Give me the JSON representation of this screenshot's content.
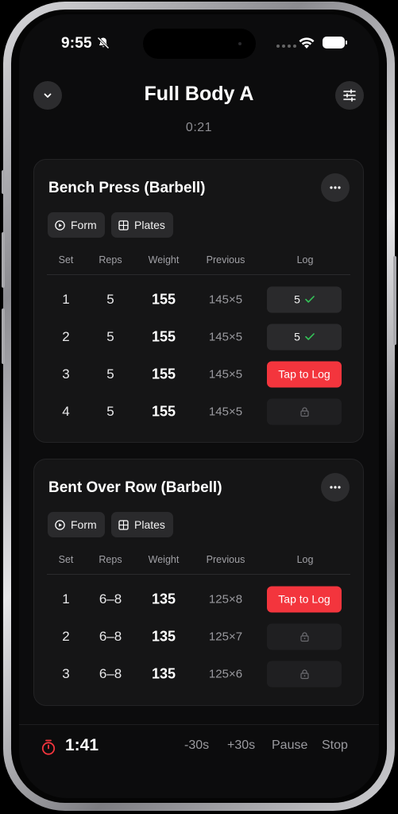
{
  "status_bar": {
    "time": "9:55"
  },
  "header": {
    "title": "Full Body A",
    "elapsed": "0:21",
    "collapse_icon": "chevron-down-icon",
    "settings_icon": "sliders-icon"
  },
  "table_headers": {
    "set": "Set",
    "reps": "Reps",
    "weight": "Weight",
    "previous": "Previous",
    "log": "Log"
  },
  "exercises": [
    {
      "name": "Bench Press (Barbell)",
      "chips": {
        "form": "Form",
        "plates": "Plates"
      },
      "sets": [
        {
          "set": "1",
          "reps": "5",
          "weight": "155",
          "previous": "145×5",
          "log": {
            "state": "done",
            "value": "5"
          }
        },
        {
          "set": "2",
          "reps": "5",
          "weight": "155",
          "previous": "145×5",
          "log": {
            "state": "done",
            "value": "5"
          }
        },
        {
          "set": "3",
          "reps": "5",
          "weight": "155",
          "previous": "145×5",
          "log": {
            "state": "active",
            "value": "Tap to Log"
          }
        },
        {
          "set": "4",
          "reps": "5",
          "weight": "155",
          "previous": "145×5",
          "log": {
            "state": "locked",
            "value": ""
          }
        }
      ]
    },
    {
      "name": "Bent Over Row (Barbell)",
      "chips": {
        "form": "Form",
        "plates": "Plates"
      },
      "sets": [
        {
          "set": "1",
          "reps": "6–8",
          "weight": "135",
          "previous": "125×8",
          "log": {
            "state": "active",
            "value": "Tap to Log"
          }
        },
        {
          "set": "2",
          "reps": "6–8",
          "weight": "135",
          "previous": "125×7",
          "log": {
            "state": "locked",
            "value": ""
          }
        },
        {
          "set": "3",
          "reps": "6–8",
          "weight": "135",
          "previous": "125×6",
          "log": {
            "state": "locked",
            "value": ""
          }
        }
      ]
    }
  ],
  "rest_timer": {
    "time": "1:41",
    "actions": {
      "minus": "-30s",
      "plus": "+30s",
      "pause": "Pause",
      "stop": "Stop"
    }
  },
  "colors": {
    "accent": "#f3353d",
    "check": "#34c759",
    "background": "#0c0c0d",
    "card": "#151516"
  }
}
